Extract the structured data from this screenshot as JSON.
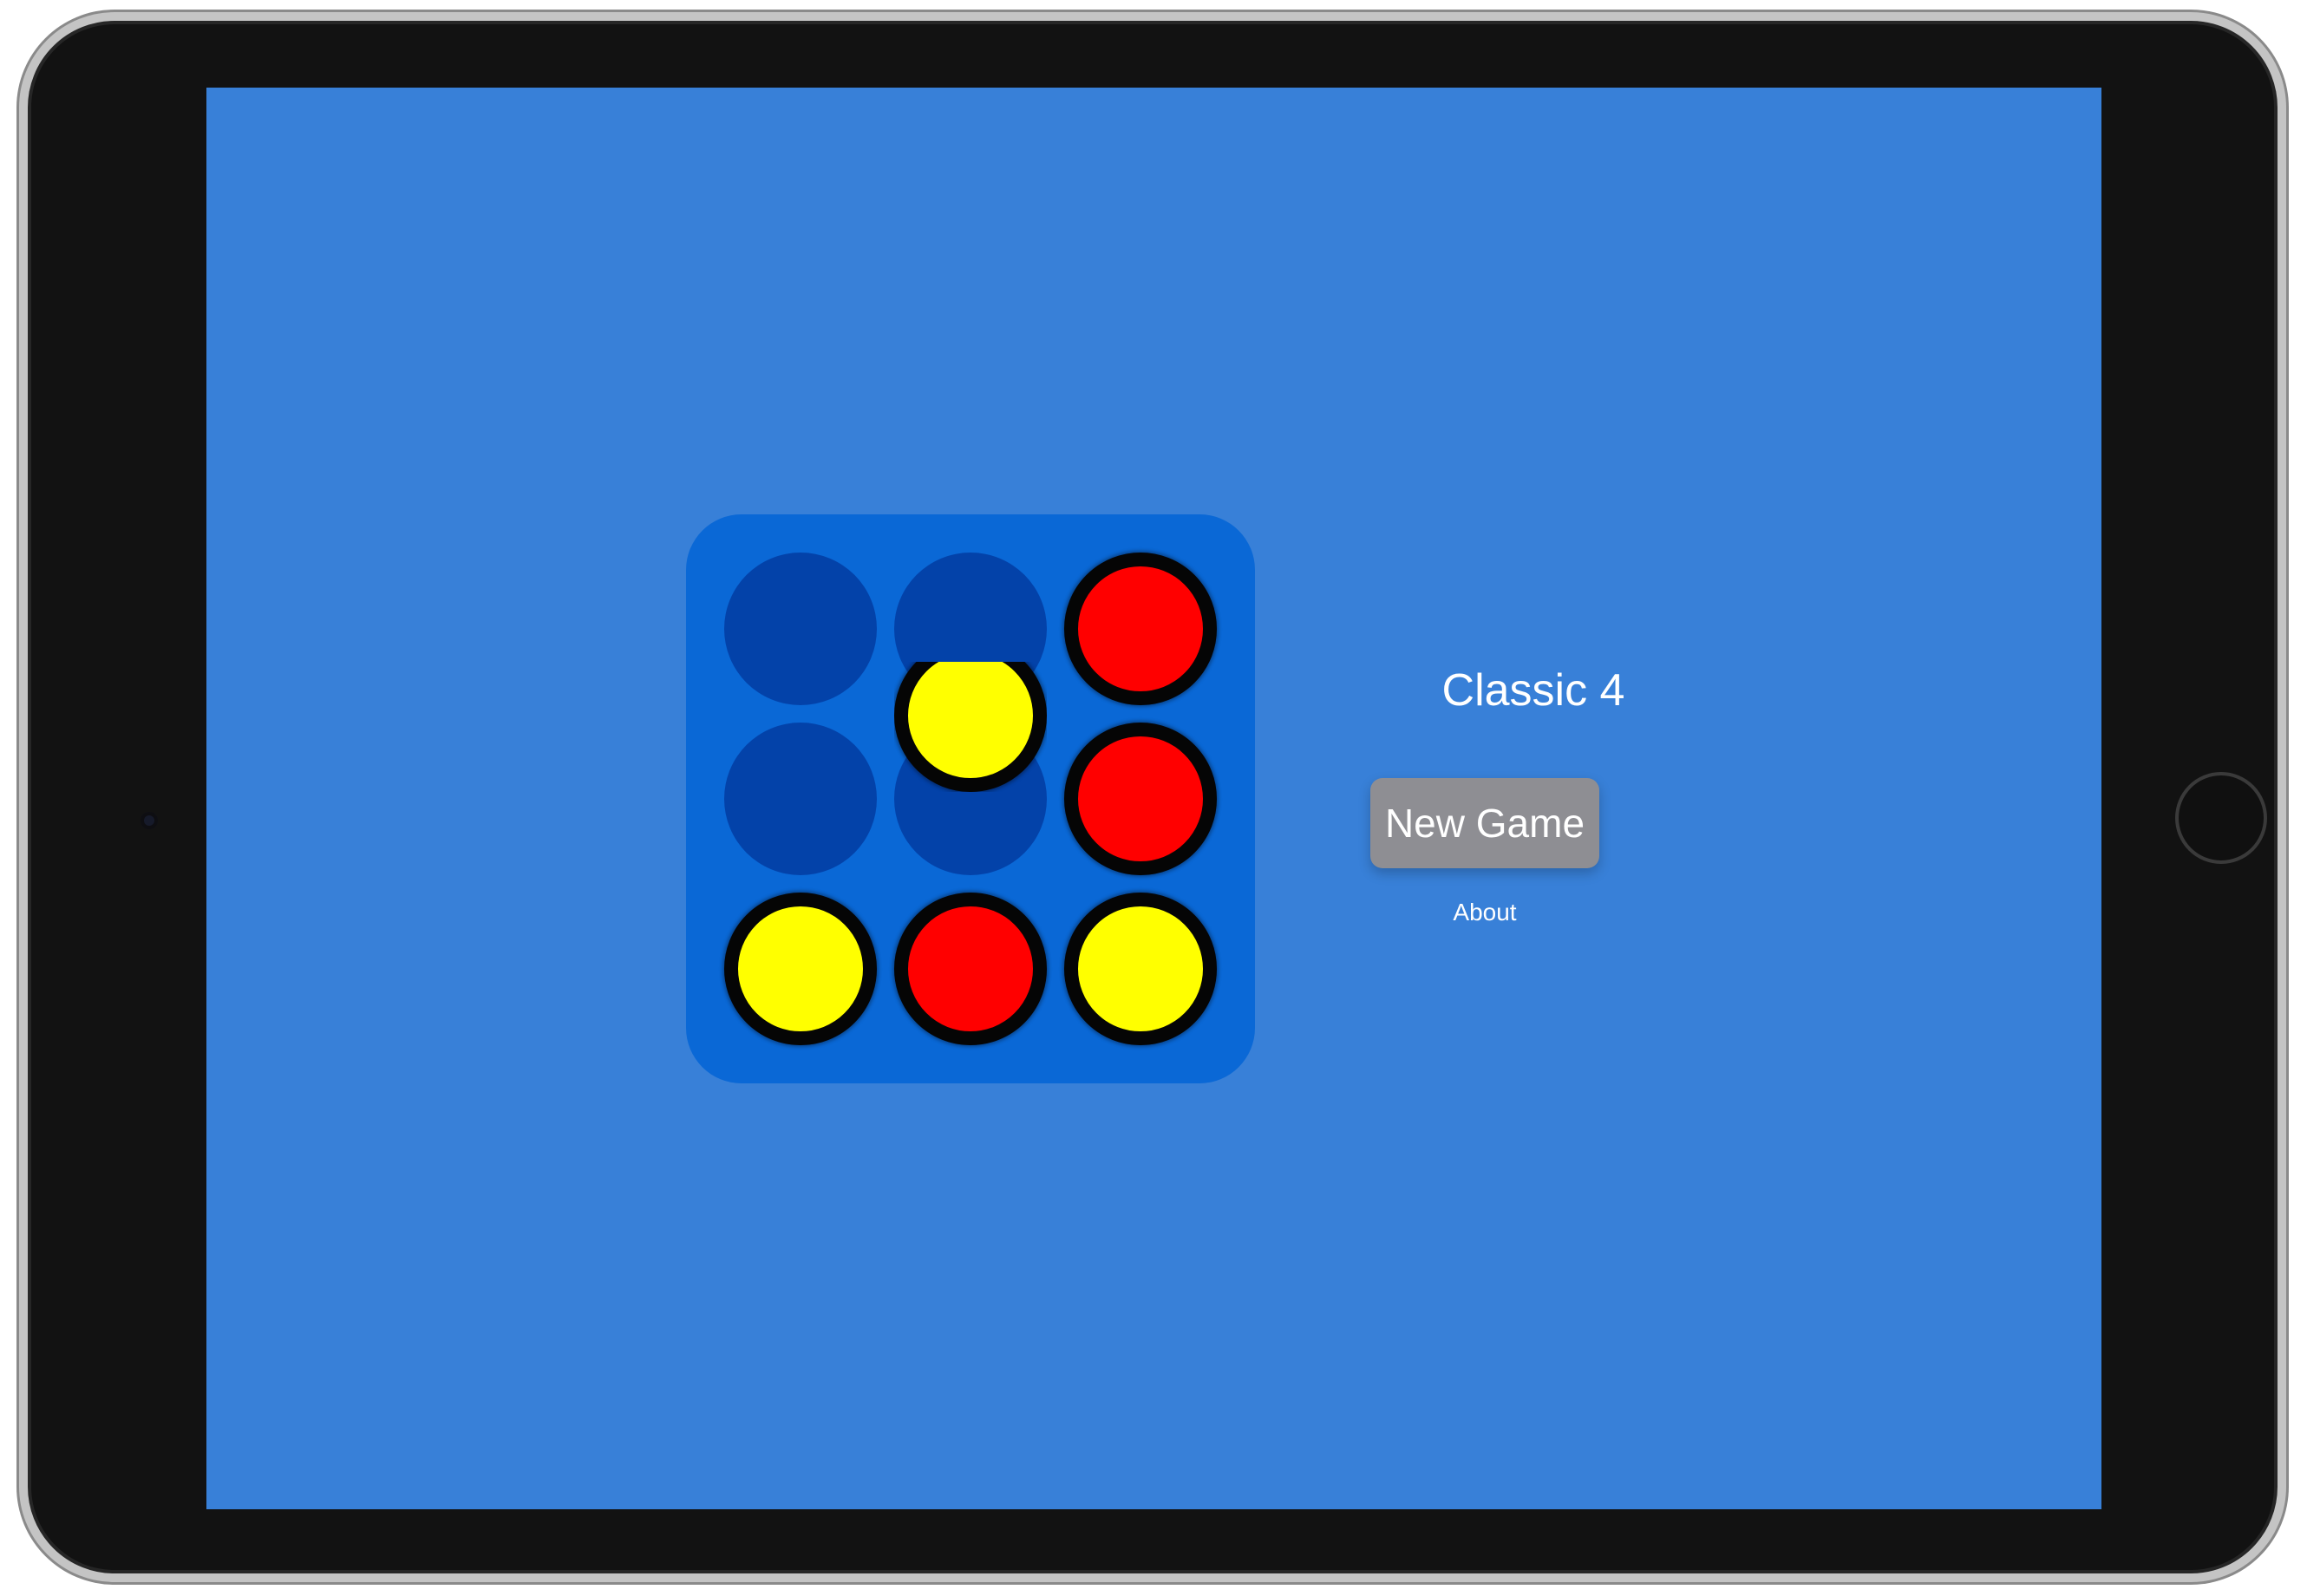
{
  "app": {
    "title": "Classic 4",
    "new_game_label": "New Game",
    "about_label": "About"
  },
  "colors": {
    "screen_background": "#3880d8",
    "board": "#0a68d6",
    "empty_slot": "#0342a9",
    "red_disc": "#ff0000",
    "yellow_disc": "#ffff00",
    "disc_rim": "#050505",
    "button": "#8e8e93",
    "text": "#ffffff"
  },
  "board": {
    "rows": 3,
    "columns": 3,
    "cells": [
      [
        "empty",
        "empty",
        "red"
      ],
      [
        "empty",
        "empty",
        "red"
      ],
      [
        "yellow",
        "red",
        "yellow"
      ]
    ],
    "falling_disc": {
      "color": "yellow",
      "column": 2
    }
  }
}
